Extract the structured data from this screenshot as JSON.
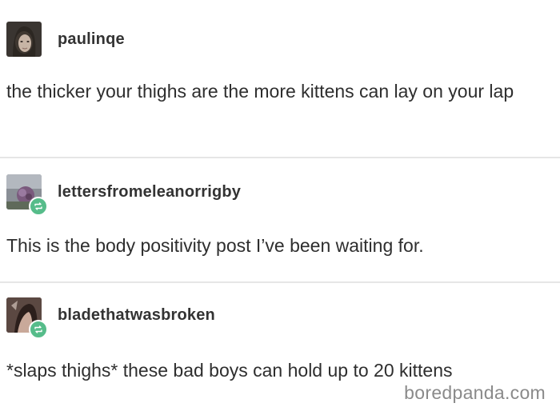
{
  "posts": [
    {
      "username": "paulinqe",
      "text": "the thicker your thighs are the more kittens can lay on your lap",
      "reblog": false
    },
    {
      "username": "lettersfromeleanorrigby",
      "text": "This is the body positivity post I’ve been waiting for.",
      "reblog": true
    },
    {
      "username": "bladethatwasbroken",
      "text": "*slaps thighs* these bad boys can hold up to 20 kittens",
      "reblog": true
    }
  ],
  "watermark": "boredpanda.com",
  "colors": {
    "reblog_badge": "#56bc8a",
    "divider": "#e6e6e6",
    "text": "#2e2e2e",
    "watermark": "#8a8a8a"
  },
  "icons": {
    "reblog": "reblog-icon"
  }
}
